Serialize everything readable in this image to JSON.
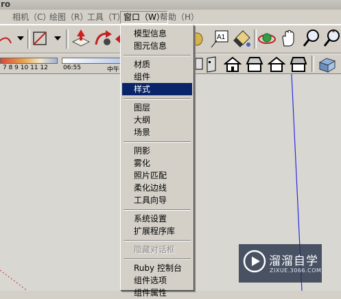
{
  "title_fragment": "ro",
  "menubar": {
    "items": [
      {
        "label": "相机（C）"
      },
      {
        "label": "绘图（R）"
      },
      {
        "label": "工具（T）"
      },
      {
        "label": "窗口（W）"
      },
      {
        "label": "帮助（H）"
      }
    ]
  },
  "shadow_settings": {
    "months": "7  8  9  10 11 12",
    "time_start": "06:55",
    "time_mid": "中午"
  },
  "toolbar": {
    "text_tool_label": "A1"
  },
  "window_menu": {
    "items": [
      {
        "label": "模型信息"
      },
      {
        "label": "图元信息"
      },
      {
        "label": "材质"
      },
      {
        "label": "组件"
      },
      {
        "label": "样式"
      },
      {
        "label": "图层"
      },
      {
        "label": "大纲"
      },
      {
        "label": "场景"
      },
      {
        "label": "阴影"
      },
      {
        "label": "雾化"
      },
      {
        "label": "照片匹配"
      },
      {
        "label": "柔化边线"
      },
      {
        "label": "工具向导"
      },
      {
        "label": "系统设置"
      },
      {
        "label": "扩展程序库"
      },
      {
        "label": "隐藏对话框"
      },
      {
        "label": "Ruby 控制台"
      },
      {
        "label": "组件选项"
      },
      {
        "label": "组件属性"
      }
    ],
    "selected": "样式"
  },
  "watermark": {
    "name": "溜溜自学",
    "url": "ZIXUE.3066.COM"
  },
  "colors": {
    "menu_selection": "#0a246a",
    "axis_blue": "#2a2ae0",
    "axis_red": "#c03030",
    "face_bg": "#d4d0c8"
  }
}
